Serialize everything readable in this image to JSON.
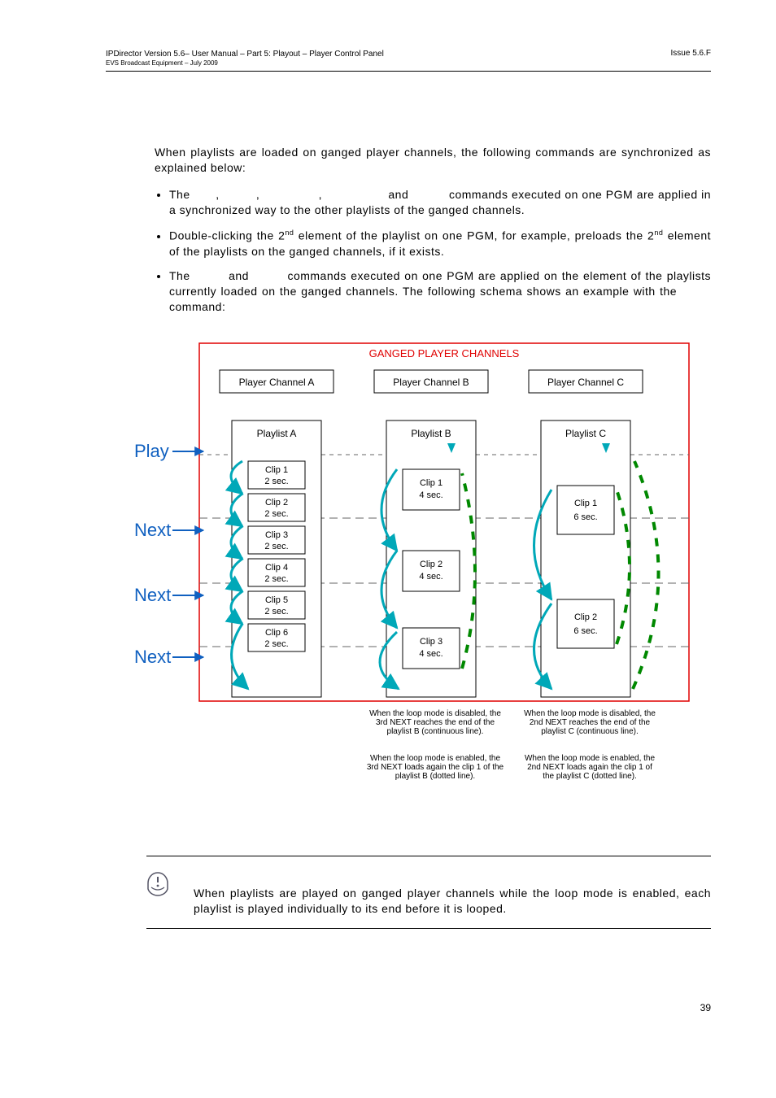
{
  "header": {
    "left_line1": "IPDirector Version 5.6– User Manual – Part 5: Playout – Player Control Panel",
    "left_line2": "EVS Broadcast Equipment – July 2009",
    "right": "Issue 5.6.F"
  },
  "intro_para": "When playlists are loaded on ganged player channels, the following commands are synchronized as explained below:",
  "bullets": {
    "b1_a": "The ",
    "b1_b": ", ",
    "b1_c": ", ",
    "b1_d": ", ",
    "b1_e": " and ",
    "b1_f": " commands executed on one PGM are applied in a synchronized way to the other playlists of the ganged channels.",
    "b2_a": "Double-clicking the 2",
    "b2_sup1": "nd",
    "b2_b": " element of the playlist on one PGM, for example, preloads the 2",
    "b2_sup2": "nd",
    "b2_c": " element of the playlists on the ganged channels, if it exists.",
    "b3_a": "The ",
    "b3_b": " and ",
    "b3_c": " commands executed on one PGM are applied on the element of the playlists currently loaded on the ganged channels. The following schema shows an example with the ",
    "b3_d": " command:"
  },
  "diagram": {
    "title": "GANGED PLAYER CHANNELS",
    "commands": {
      "play": "Play",
      "next": "Next"
    },
    "colA": {
      "header": "Player Channel A",
      "playlist": "Playlist A",
      "clips": [
        "Clip 1",
        "2 sec.",
        "Clip 2",
        "2 sec.",
        "Clip 3",
        "2 sec.",
        "Clip 4",
        "2 sec.",
        "Clip 5",
        "2 sec.",
        "Clip 6",
        "2 sec."
      ]
    },
    "colB": {
      "header": "Player Channel B",
      "playlist": "Playlist B",
      "clips": [
        "Clip 1",
        "4 sec.",
        "Clip 2",
        "4 sec.",
        "Clip 3",
        "4 sec."
      ],
      "caption1": "When the loop mode is disabled, the 3rd NEXT reaches the end of the playlist B (continuous line).",
      "caption2": "When the loop mode is enabled, the 3rd NEXT loads again the clip 1 of the playlist B (dotted line)."
    },
    "colC": {
      "header": "Player Channel C",
      "playlist": "Playlist C",
      "clips": [
        "Clip 1",
        "6 sec.",
        "Clip 2",
        "6 sec."
      ],
      "caption1": "When the loop mode is disabled, the 2nd NEXT reaches the end of the playlist C (continuous line).",
      "caption2": "When the loop mode is enabled, the 2nd NEXT loads again the clip 1 of the playlist C (dotted line)."
    }
  },
  "note": "When playlists are played on ganged player channels while the loop mode is enabled, each playlist is played individually to its end before it is looped.",
  "page_number": "39"
}
